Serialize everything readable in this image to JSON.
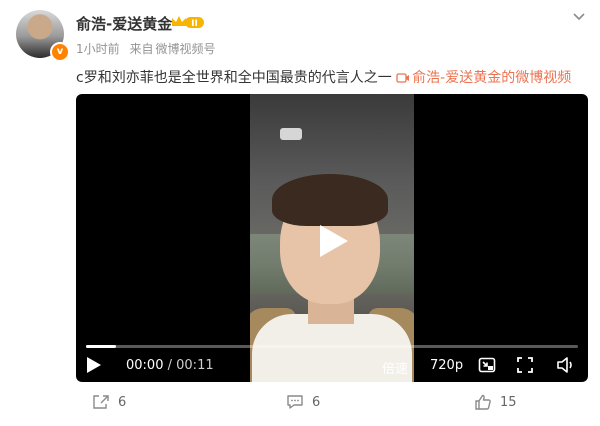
{
  "author": {
    "name": "俞浩-爱送黄金",
    "badge_level": "II",
    "verified_mark": "v"
  },
  "meta": {
    "time": "1小时前",
    "source_prefix": "来自",
    "source": "微博视频号"
  },
  "post": {
    "text": "c罗和刘亦菲也是全世界和全中国最贵的代言人之一",
    "video_link_label": "俞浩-爱送黄金的微博视频"
  },
  "player": {
    "current_time": "00:00",
    "separator": "/",
    "duration": "00:11",
    "progress_fraction": 0.06,
    "speed_label": "倍速",
    "quality_label": "720p"
  },
  "actions": {
    "share_count": "6",
    "comment_count": "6",
    "like_count": "15"
  },
  "colors": {
    "accent": "#ff8200",
    "link": "#eb7350"
  }
}
